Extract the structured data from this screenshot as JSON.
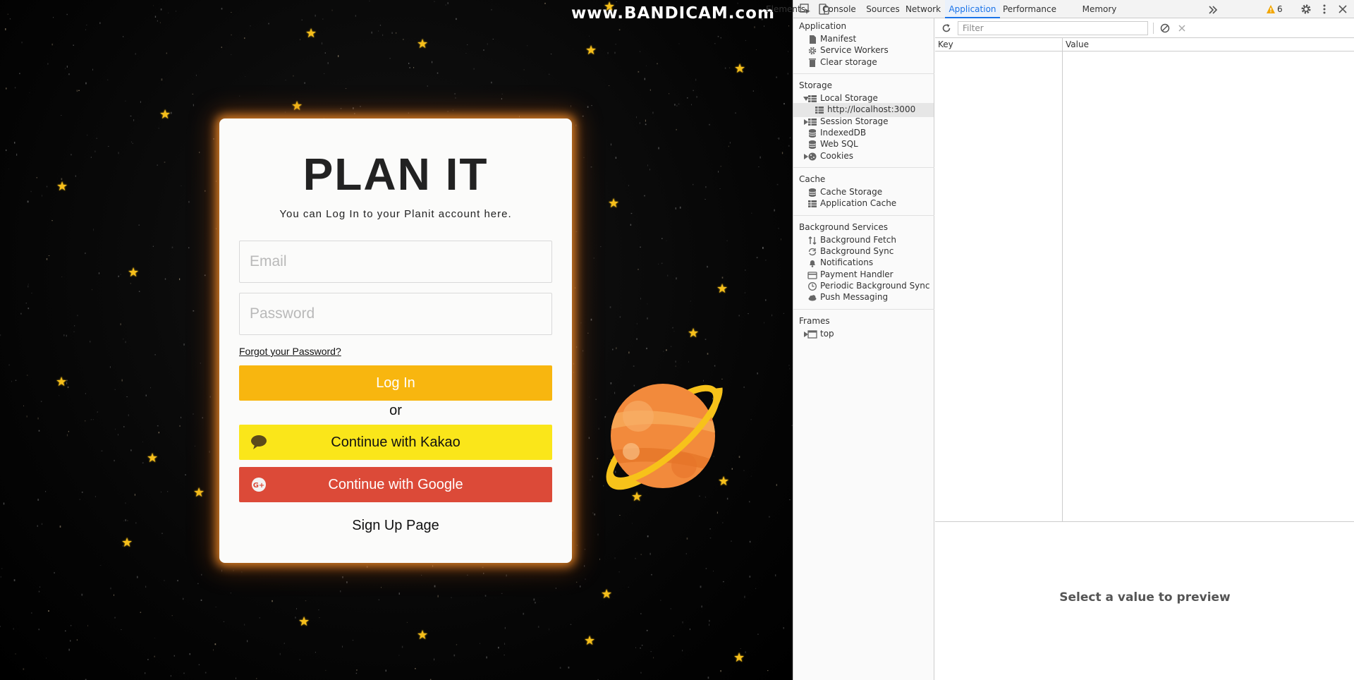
{
  "watermark": "www.BANDICAM.com",
  "app": {
    "title": "PLAN IT",
    "subtitle": "You can Log In to your Planit account here.",
    "email_placeholder": "Email",
    "password_placeholder": "Password",
    "forgot_label": "Forgot your Password?",
    "login_label": "Log In",
    "or_label": "or",
    "kakao_label": "Continue with Kakao",
    "google_label": "Continue with Google",
    "signup_label": "Sign Up Page",
    "colors": {
      "login": "#f8b60f",
      "kakao": "#fae61a",
      "google": "#dc4a38",
      "star": "#f6bf1b",
      "planet": "#f28a3c",
      "ring": "#f7c21a"
    }
  },
  "devtools": {
    "tabs": [
      "Elements",
      "Console",
      "Sources",
      "Network",
      "Application",
      "Performance",
      "Memory"
    ],
    "active_tab": "Application",
    "more_tabs_icon": "chevron-double-right-icon",
    "warning_count": "6",
    "sidebar": {
      "application_title": "Application",
      "application_items": [
        {
          "label": "Manifest",
          "icon": "file-icon"
        },
        {
          "label": "Service Workers",
          "icon": "gear-icon"
        },
        {
          "label": "Clear storage",
          "icon": "trash-icon"
        }
      ],
      "storage_title": "Storage",
      "storage_items": [
        {
          "label": "Local Storage",
          "icon": "table-icon",
          "expanded": true
        },
        {
          "label": "http://localhost:3000",
          "icon": "table-icon",
          "selected": true
        },
        {
          "label": "Session Storage",
          "icon": "table-icon",
          "expanded": false
        },
        {
          "label": "IndexedDB",
          "icon": "database-icon"
        },
        {
          "label": "Web SQL",
          "icon": "database-icon"
        },
        {
          "label": "Cookies",
          "icon": "cookie-icon",
          "expanded": false
        }
      ],
      "cache_title": "Cache",
      "cache_items": [
        {
          "label": "Cache Storage",
          "icon": "database-icon"
        },
        {
          "label": "Application Cache",
          "icon": "table-icon"
        }
      ],
      "bg_title": "Background Services",
      "bg_items": [
        {
          "label": "Background Fetch",
          "icon": "arrows-updown-icon"
        },
        {
          "label": "Background Sync",
          "icon": "sync-icon"
        },
        {
          "label": "Notifications",
          "icon": "bell-icon"
        },
        {
          "label": "Payment Handler",
          "icon": "card-icon"
        },
        {
          "label": "Periodic Background Sync",
          "icon": "clock-icon"
        },
        {
          "label": "Push Messaging",
          "icon": "cloud-icon"
        }
      ],
      "frames_title": "Frames",
      "frames_items": [
        {
          "label": "top",
          "icon": "frame-icon",
          "expanded": false
        }
      ]
    },
    "filter_placeholder": "Filter",
    "columns": [
      "Key",
      "Value"
    ],
    "preview_text": "Select a value to preview"
  }
}
